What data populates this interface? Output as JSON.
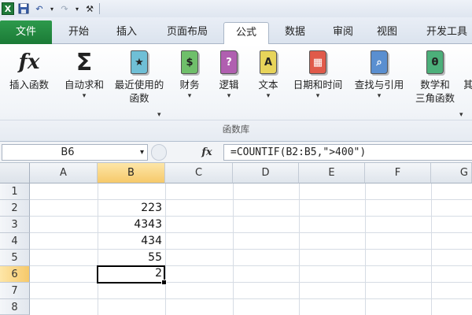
{
  "qat": {
    "excel_icon": "X",
    "undo_glyph": "↶",
    "redo_glyph": "↷",
    "tool_glyph": "⚒"
  },
  "tabs": [
    {
      "label": "文件"
    },
    {
      "label": "开始"
    },
    {
      "label": "插入"
    },
    {
      "label": "页面布局"
    },
    {
      "label": "公式"
    },
    {
      "label": "数据"
    },
    {
      "label": "审阅"
    },
    {
      "label": "视图"
    },
    {
      "label": "开发工具"
    }
  ],
  "ribbon": {
    "insert_function": {
      "icon_text": "fx",
      "label": "插入函数"
    },
    "autosum": {
      "icon_text": "Σ",
      "line1": "自动求和",
      "arrow": "▾"
    },
    "recent": {
      "line1": "最近使用的",
      "line2": "函数",
      "arrow": "▾",
      "icon_text": "★"
    },
    "financial": {
      "line1": "财务",
      "arrow": "▾",
      "icon_text": "$"
    },
    "logical": {
      "line1": "逻辑",
      "arrow": "▾",
      "icon_text": "?"
    },
    "text": {
      "line1": "文本",
      "arrow": "▾",
      "icon_text": "A"
    },
    "datetime": {
      "line1": "日期和时间",
      "arrow": "▾",
      "icon_text": "▦"
    },
    "lookup": {
      "line1": "查找与引用",
      "arrow": "▾",
      "icon_text": "⌕"
    },
    "math": {
      "line1": "数学和",
      "line2": "三角函数",
      "arrow": "▾",
      "icon_text": "θ"
    },
    "more": {
      "line1": "其"
    },
    "group_label": "函数库",
    "colors": {
      "recent": "#6fbfd6",
      "financial": "#6fbf6a",
      "logical": "#b05fb0",
      "text": "#e8d45a",
      "datetime": "#e05a4a",
      "lookup": "#5a8fd0",
      "math": "#4caf7a"
    }
  },
  "formula_bar": {
    "name_box": "B6",
    "dropdown": "▾",
    "fx": "fx",
    "formula": "=COUNTIF(B2:B5,\">400\")"
  },
  "grid": {
    "columns": [
      "A",
      "B",
      "C",
      "D",
      "E",
      "F",
      "G"
    ],
    "rows": [
      "1",
      "2",
      "3",
      "4",
      "5",
      "6",
      "7",
      "8"
    ],
    "selected_column": "B",
    "selected_row": "6",
    "cells": {
      "B2": "223",
      "B3": "4343",
      "B4": "434",
      "B5": "55",
      "B6": "2"
    }
  }
}
